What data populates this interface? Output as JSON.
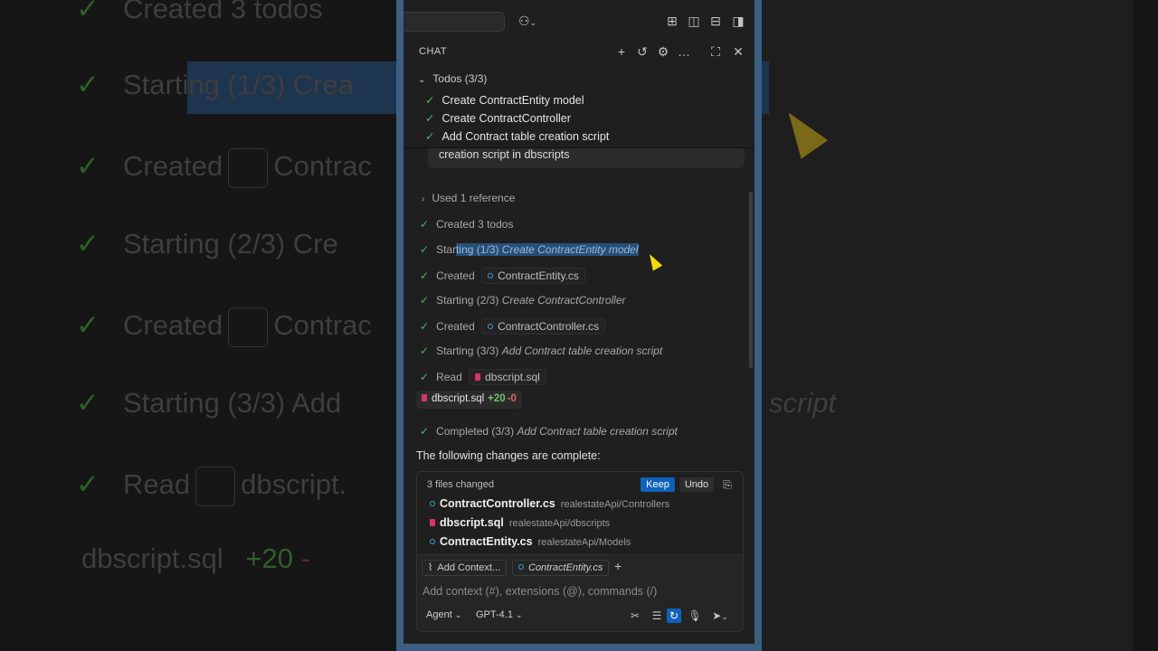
{
  "background": {
    "lines": [
      {
        "text": "Created 3 todos",
        "icon": false
      },
      {
        "text": "Starting (1/3) Crea",
        "italic_part": "",
        "icon": false
      },
      {
        "text": "Created",
        "chip": "Contrac",
        "icon": true
      },
      {
        "text": "Starting (2/3) Cre",
        "icon": false
      },
      {
        "text": "Created",
        "chip": "Contrac",
        "icon": true
      },
      {
        "text": "Starting (3/3) Add",
        "tail": "script",
        "icon": false
      },
      {
        "text": "Read",
        "chip": "dbscript.",
        "icon": true
      },
      {
        "text": "dbscript.sql",
        "plus": "+20",
        "minus": "-",
        "icon": true
      }
    ]
  },
  "titlebar": {
    "icons": [
      "copilot-icon",
      "layout-icon",
      "sidebar-left-icon",
      "panel-bottom-icon",
      "sidebar-right-icon"
    ]
  },
  "chat": {
    "label": "CHAT",
    "icons": [
      "plus-icon",
      "history-icon",
      "gear-icon",
      "more-icon",
      "maximize-icon",
      "close-icon"
    ]
  },
  "todos": {
    "header": "Todos (3/3)",
    "items": [
      "Create ContractEntity model",
      "Create ContractController",
      "Add Contract table creation script"
    ]
  },
  "bubble_text": "creation script in dbscripts",
  "progress": {
    "reference": "Used 1 reference",
    "created_todos": "Created 3 todos",
    "start1_prefix": "Star",
    "start1_sel_a": "ting (1/3) ",
    "start1_sel_b": "Create ContractEntity model",
    "created_label": "Created",
    "file1": "ContractEntity.cs",
    "start2_prefix": "Starting (2/3) ",
    "start2_italic": "Create ContractController",
    "file2": "ContractController.cs",
    "start3_prefix": "Starting (3/3) ",
    "start3_italic": "Add Contract table creation script",
    "read_label": "Read",
    "file3": "dbscript.sql",
    "sql_chip": "dbscript.sql",
    "sql_plus": "+20",
    "sql_minus": "-0",
    "completed_prefix": "Completed (3/3) ",
    "completed_italic": "Add Contract table creation script"
  },
  "complete_text": "The following changes are complete:",
  "changes": {
    "count": "3 files changed",
    "keep": "Keep",
    "undo": "Undo",
    "files": [
      {
        "name": "ContractController.cs",
        "path": "realestateApi/Controllers",
        "type": "cs"
      },
      {
        "name": "dbscript.sql",
        "path": "realestateApi/dbscripts",
        "type": "sql"
      },
      {
        "name": "ContractEntity.cs",
        "path": "realestateApi/Models",
        "type": "cs"
      }
    ]
  },
  "input": {
    "add_context": "Add Context...",
    "context_file": "ContractEntity.cs",
    "placeholder": "Add context (#), extensions (@), commands (/)",
    "mode": "Agent",
    "model": "GPT-4.1"
  },
  "colors": {
    "accent": "#0e62b8",
    "check": "#4fb06d",
    "selection": "#264f78",
    "frame": "#3b5f83"
  }
}
